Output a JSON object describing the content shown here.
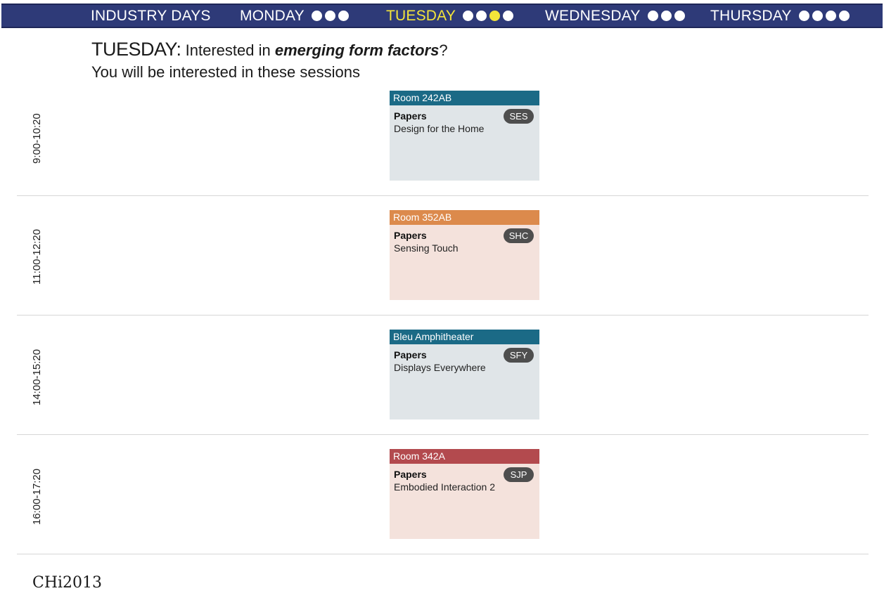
{
  "colors": {
    "nav_background": "#2e3a78",
    "active_day": "#f4e53a",
    "room_teal": "#1b6a86",
    "room_orange": "#dc8a4c",
    "room_red": "#b34a4e",
    "card_gray": "#e0e5e8",
    "card_peach": "#f4e2dc"
  },
  "nav": {
    "items": [
      {
        "label": "INDUSTRY DAYS",
        "dots": 0,
        "active_dot": -1
      },
      {
        "label": "MONDAY",
        "dots": 3,
        "active_dot": -1
      },
      {
        "label": "TUESDAY",
        "dots": 4,
        "active_dot": 2
      },
      {
        "label": "WEDNESDAY",
        "dots": 3,
        "active_dot": -1
      },
      {
        "label": "THURSDAY",
        "dots": 4,
        "active_dot": -1
      }
    ]
  },
  "heading": {
    "day": "TUESDAY:",
    "prefix": " Interested in ",
    "topic": "emerging form factors",
    "suffix": "?",
    "subtitle": "You will be interested in these sessions"
  },
  "slots": [
    {
      "time": "9:00-10:20",
      "room": "Room 242AB",
      "room_color": "#1b6a86",
      "body_color": "#e0e5e8",
      "type": "Papers",
      "title": "Design for the Home",
      "code": "SES"
    },
    {
      "time": "11:00-12:20",
      "room": "Room 352AB",
      "room_color": "#dc8a4c",
      "body_color": "#f4e2dc",
      "type": "Papers",
      "title": "Sensing Touch",
      "code": "SHC"
    },
    {
      "time": "14:00-15:20",
      "room": "Bleu Amphitheater",
      "room_color": "#1b6a86",
      "body_color": "#e0e5e8",
      "type": "Papers",
      "title": "Displays Everywhere",
      "code": "SFY"
    },
    {
      "time": "16:00-17:20",
      "room": "Room 342A",
      "room_color": "#b34a4e",
      "body_color": "#f4e2dc",
      "type": "Papers",
      "title": "Embodied Interaction 2",
      "code": "SJP"
    }
  ],
  "footer": {
    "logo": "CHi2013"
  }
}
